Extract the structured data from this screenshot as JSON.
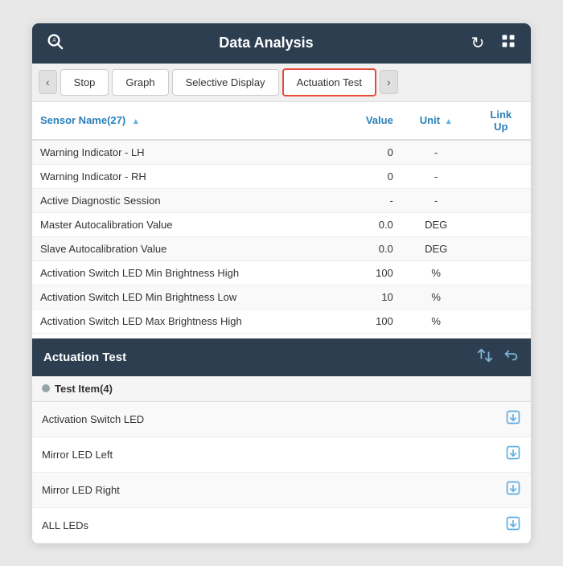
{
  "header": {
    "title": "Data Analysis",
    "search_icon": "🔍",
    "refresh_icon": "↻",
    "grid_icon": "⊞"
  },
  "toolbar": {
    "nav_prev": "‹",
    "nav_next": "›",
    "tabs": [
      {
        "id": "stop",
        "label": "Stop",
        "active": false
      },
      {
        "id": "graph",
        "label": "Graph",
        "active": false
      },
      {
        "id": "selective-display",
        "label": "Selective Display",
        "active": false
      },
      {
        "id": "actuation-test",
        "label": "Actuation Test",
        "active": true
      }
    ]
  },
  "sensor_table": {
    "columns": {
      "name": "Sensor Name(27)",
      "value": "Value",
      "unit": "Unit",
      "link_up": "Link Up"
    },
    "rows": [
      {
        "name": "Warning Indicator - LH",
        "value": "0",
        "unit": "-"
      },
      {
        "name": "Warning Indicator - RH",
        "value": "0",
        "unit": "-"
      },
      {
        "name": "Active Diagnostic Session",
        "value": "-",
        "unit": "-"
      },
      {
        "name": "Master Autocalibration Value",
        "value": "0.0",
        "unit": "DEG"
      },
      {
        "name": "Slave Autocalibration Value",
        "value": "0.0",
        "unit": "DEG"
      },
      {
        "name": "Activation Switch LED Min Brightness High",
        "value": "100",
        "unit": "%"
      },
      {
        "name": "Activation Switch LED Min Brightness Low",
        "value": "10",
        "unit": "%"
      },
      {
        "name": "Activation Switch LED Max Brightness High",
        "value": "100",
        "unit": "%"
      }
    ]
  },
  "actuation_test": {
    "title": "Actuation Test",
    "swap_icon": "⇄",
    "back_icon": "↩",
    "test_item_label": "Test Item(4)",
    "items": [
      {
        "name": "Activation Switch LED"
      },
      {
        "name": "Mirror LED Left"
      },
      {
        "name": "Mirror LED Right"
      },
      {
        "name": "ALL LEDs"
      }
    ]
  }
}
